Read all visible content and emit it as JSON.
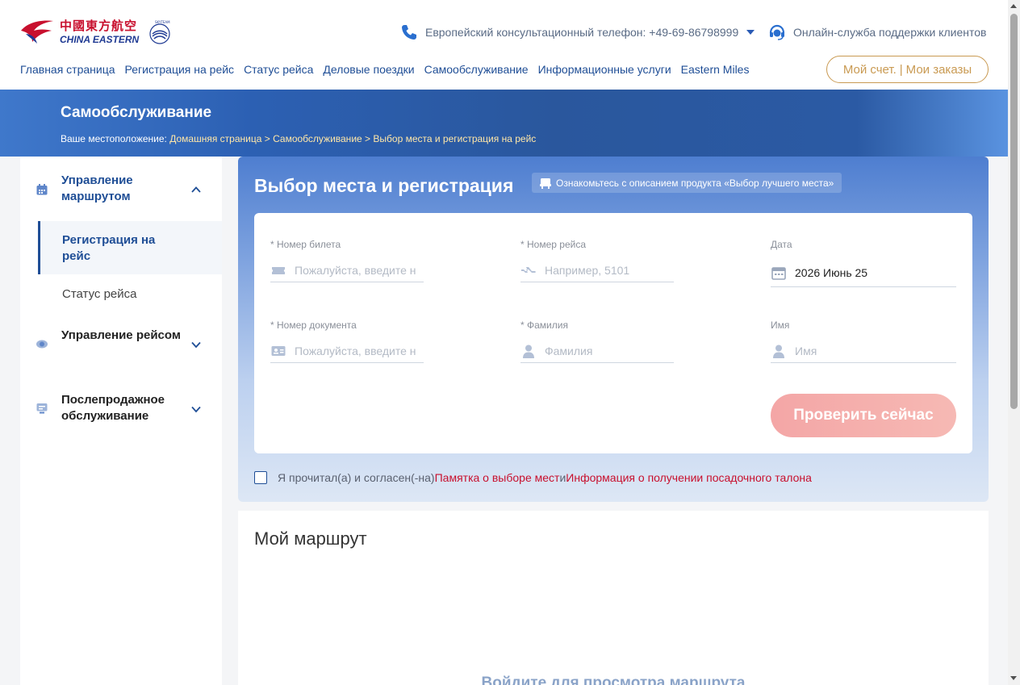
{
  "brand": {
    "name_cn": "中國東方航空",
    "name_en": "CHINA EASTERN",
    "alliance": "SKYTEAM"
  },
  "header": {
    "phone_text": "Европейский консультационный телефон: +49-69-86798999",
    "support_text": "Онлайн-служба поддержки клиентов",
    "account": {
      "account_label": "Мой счет.",
      "separator": "|",
      "orders_label": "Мои заказы"
    }
  },
  "nav": [
    "Главная страница",
    "Регистрация на рейс",
    "Статус рейса",
    "Деловые поездки",
    "Самообслуживание",
    "Информационные услуги",
    "Eastern Miles"
  ],
  "banner": {
    "title": "Самообслуживание",
    "location_label": "Ваше местоположение: ",
    "crumbs": [
      "Домашняя страница",
      "Самообслуживание",
      "Выбор места и регистрация на рейс"
    ],
    "separator": " > "
  },
  "sidebar": {
    "group1": "Управление маршрутом",
    "active_item": "Регистрация на рейс",
    "sub_item": "Статус рейса",
    "group2": "Управление рейсом",
    "group3": "Послепродажное обслуживание"
  },
  "form": {
    "title": "Выбор места и регистрация",
    "product_link": "Ознакомьтесь с описанием продукта «Выбор лучшего места»",
    "ticket_label": "* Номер билета",
    "ticket_placeholder": "Пожалуйста, введите номер билета",
    "flight_label": "* Номер рейса",
    "flight_placeholder": "Например, 5101",
    "date_label": "Дата",
    "date_value": "2026 Июнь 25",
    "doc_label": "* Номер документа",
    "doc_placeholder": "Пожалуйста, введите номер документа",
    "surname_label": "* Фамилия",
    "surname_placeholder": "Фамилия",
    "name_label": "Имя",
    "name_placeholder": "Имя",
    "submit": "Проверить сейчас"
  },
  "agreement": {
    "prefix": "Я прочитал(а) и согласен(-на) ",
    "link1": "Памятка о выборе мест",
    "conj": " и ",
    "link2": "Информация о получении посадочного талона",
    "checked": false
  },
  "itinerary": {
    "title": "Мой маршрут",
    "login_prompt": "Войдите для просмотра маршрута"
  },
  "colors": {
    "brand_blue": "#1f4e96",
    "brand_red": "#c8102e",
    "gold": "#c99a52",
    "submit": "#f4a6a6"
  }
}
